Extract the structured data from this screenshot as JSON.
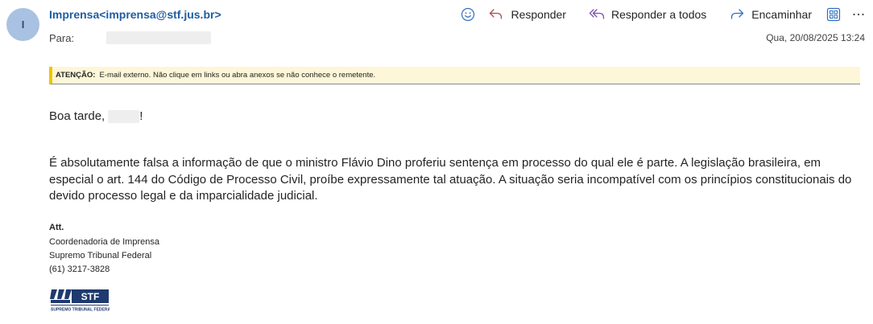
{
  "sender": {
    "avatar_initial": "I",
    "display": "Imprensa<imprensa@stf.jus.br>"
  },
  "recipient": {
    "label": "Para:"
  },
  "actions": {
    "reply": "Responder",
    "reply_all": "Responder a todos",
    "forward": "Encaminhar"
  },
  "date": "Qua, 20/08/2025 13:24",
  "warning": {
    "label": "ATENÇÃO:",
    "text": "E-mail externo. Não clique em links ou abra anexos se não conhece o remetente."
  },
  "body": {
    "greeting_prefix": "Boa tarde,",
    "greeting_suffix": "!",
    "paragraph": "É absolutamente falsa a informação de que o ministro Flávio Dino proferiu sentença em processo do qual ele é parte. A legislação brasileira, em especial o art. 144 do Código de Processo Civil, proíbe expressamente tal atuação. A situação seria incompatível com os princípios constitucionais do devido processo legal e da imparcialidade judicial."
  },
  "signature": {
    "closing": "Att.",
    "lines": [
      "Coordenadoria de Imprensa",
      "Supremo Tribunal Federal",
      "(61) 3217-3828"
    ]
  },
  "logo": {
    "text": "STF",
    "subtitle": "SUPREMO TRIBUNAL FEDERAL"
  },
  "colors": {
    "link": "#1e5da0",
    "icon_blue": "#2f6fbf",
    "reply_icon": "#b04a4a",
    "reply_all_icon": "#7a4fb0",
    "warning_bg": "#fdf6d8",
    "warning_border": "#f2c500",
    "logo_navy": "#1f3a6e"
  }
}
